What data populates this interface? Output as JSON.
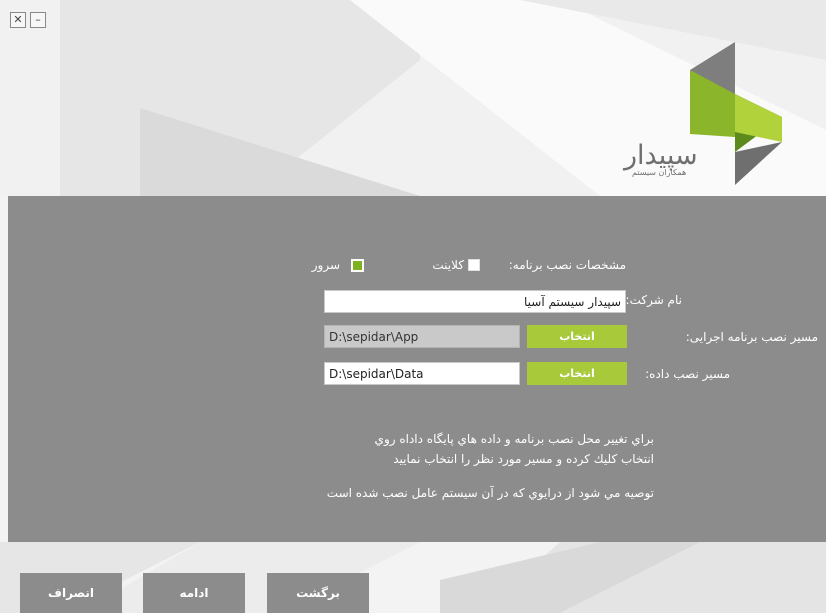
{
  "window": {
    "close_glyph": "✕",
    "minimize_glyph": "–"
  },
  "logo": {
    "name": "سپیدار",
    "subtitle": "همکاران سیستم",
    "colors": {
      "green_light": "#b2d23c",
      "green_dark": "#6e9a22",
      "gray": "#6f6f6f"
    }
  },
  "form": {
    "install_specs_label": "مشخصات نصب برنامه:",
    "client_label": "کلاینت",
    "client_checked": false,
    "server_label": "سرور",
    "server_checked": true,
    "company_label": "نام شرکت:",
    "company_value": "سپیدار سیستم آسیا",
    "app_path_label": "مسیر نصب برنامه اجرایی:",
    "app_path_value": "D:\\sepidar\\App",
    "data_path_label": "مسیر نصب داده:",
    "data_path_value": "D:\\sepidar\\Data",
    "select_label": "انتخاب",
    "help_line1": "براي تغيير محل نصب برنامه و داده هاي پايگاه داداه روي",
    "help_line2": "انتخاب كليك كرده و مسير مورد نظر را انتخاب نماييد",
    "help_line3": "توصيه مي شود از درايوي كه در آن سيستم عامل نصب شده است"
  },
  "footer": {
    "cancel_label": "انصراف",
    "continue_label": "ادامه",
    "back_label": "برگشت"
  },
  "colors": {
    "panel": "#8c8c8c",
    "accent": "#a7c93a",
    "background": "#f3f3f3"
  }
}
